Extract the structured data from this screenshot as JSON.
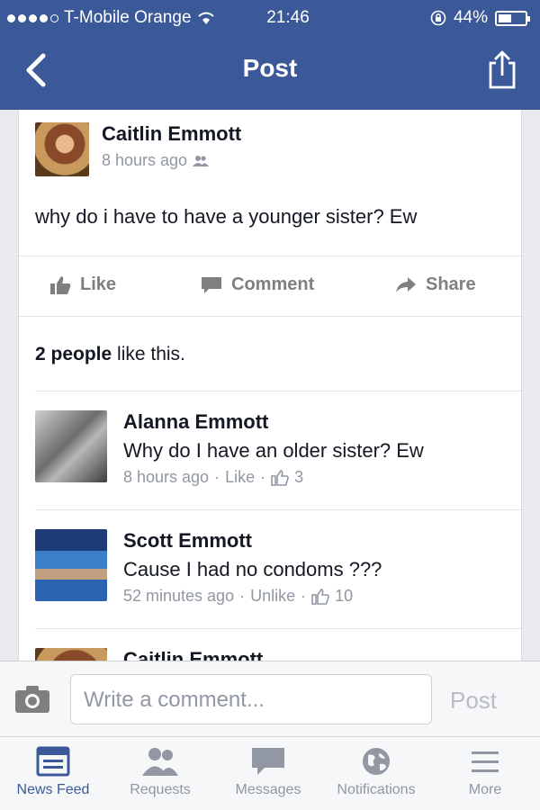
{
  "status_bar": {
    "carrier": "T-Mobile Orange",
    "time": "21:46",
    "battery": "44%"
  },
  "nav": {
    "title": "Post"
  },
  "post": {
    "author": "Caitlin Emmott",
    "time": "8 hours ago",
    "text": "why do i have to have a younger sister? Ew",
    "actions": {
      "like": "Like",
      "comment": "Comment",
      "share": "Share"
    },
    "likes_count": "2 people",
    "likes_suffix": " like this."
  },
  "comments": [
    {
      "author": "Alanna Emmott",
      "text": "Why do I have an older sister? Ew",
      "time": "8 hours ago",
      "action": "Like",
      "likes": "3"
    },
    {
      "author": "Scott Emmott",
      "text": "Cause I had no condoms ???",
      "time": "52 minutes ago",
      "action": "Unlike",
      "likes": "10"
    },
    {
      "author": "Caitlin Emmott"
    }
  ],
  "compose": {
    "placeholder": "Write a comment...",
    "post_label": "Post"
  },
  "tabs": [
    {
      "label": "News Feed",
      "active": true
    },
    {
      "label": "Requests"
    },
    {
      "label": "Messages"
    },
    {
      "label": "Notifications"
    },
    {
      "label": "More"
    }
  ],
  "colors": {
    "brand": "#3b5998",
    "meta": "#9197a3"
  }
}
